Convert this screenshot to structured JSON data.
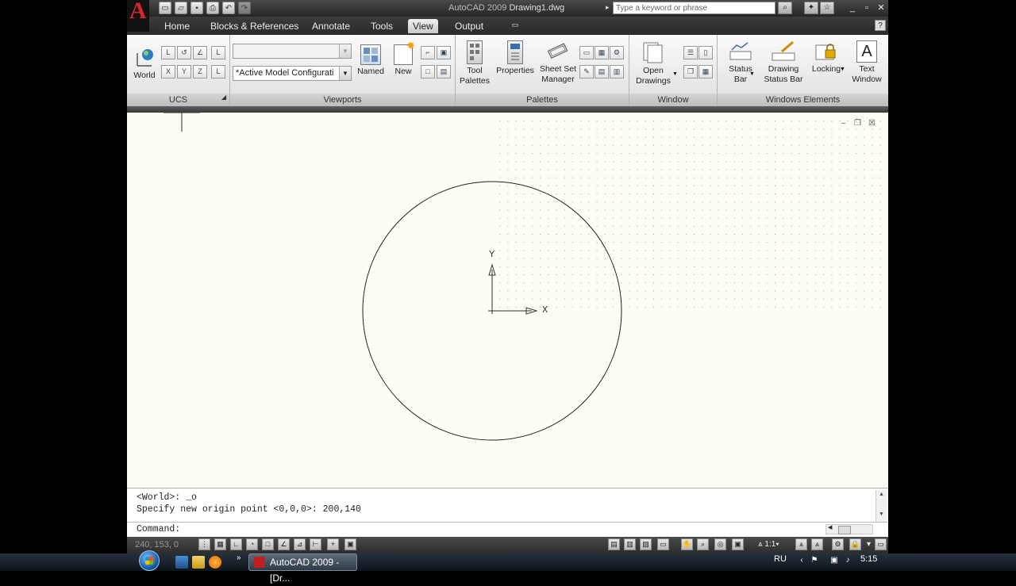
{
  "app": {
    "title_app": "AutoCAD 2009",
    "title_doc": "Drawing1.dwg"
  },
  "search": {
    "placeholder": "Type a keyword or phrase"
  },
  "tabs": [
    {
      "label": "Home"
    },
    {
      "label": "Blocks & References"
    },
    {
      "label": "Annotate"
    },
    {
      "label": "Tools"
    },
    {
      "label": "View"
    },
    {
      "label": "Output"
    }
  ],
  "active_tab": "View",
  "ribbon": {
    "ucs": {
      "title": "UCS",
      "world_label": "World"
    },
    "viewports": {
      "title": "Viewports",
      "combo_top_value": "",
      "combo_config_value": "*Active Model Configurati",
      "named_label": "Named",
      "new_label": "New"
    },
    "palettes": {
      "title": "Palettes",
      "tool_palettes_line1": "Tool",
      "tool_palettes_line2": "Palettes",
      "properties_label": "Properties",
      "sheet_set_line1": "Sheet Set",
      "sheet_set_line2": "Manager"
    },
    "window": {
      "title": "Window",
      "open_drawings_line1": "Open",
      "open_drawings_line2": "Drawings"
    },
    "windows_elements": {
      "title": "Windows Elements",
      "status_bar_line1": "Status",
      "status_bar_line2": "Bar",
      "drawing_status_line1": "Drawing",
      "drawing_status_line2": "Status Bar",
      "locking_label": "Locking",
      "text_window_line1": "Text",
      "text_window_line2": "Window"
    }
  },
  "drawing": {
    "ucs_y_label": "Y",
    "ucs_x_label": "X"
  },
  "command": {
    "history": [
      "<World>: _o",
      "Specify new origin point <0,0,0>: 200,140"
    ],
    "prompt": "Command:"
  },
  "status": {
    "coordinates": "240, 153, 0",
    "annotation_scale": "1:1"
  },
  "taskbar": {
    "task_label": "AutoCAD 2009 - [Dr...",
    "language": "RU",
    "time": "5:15"
  },
  "colors": {
    "canvas_bg": "#fdfdf3",
    "brand_red": "#d8242c",
    "ribbon_bg": "#f0f0f0"
  }
}
